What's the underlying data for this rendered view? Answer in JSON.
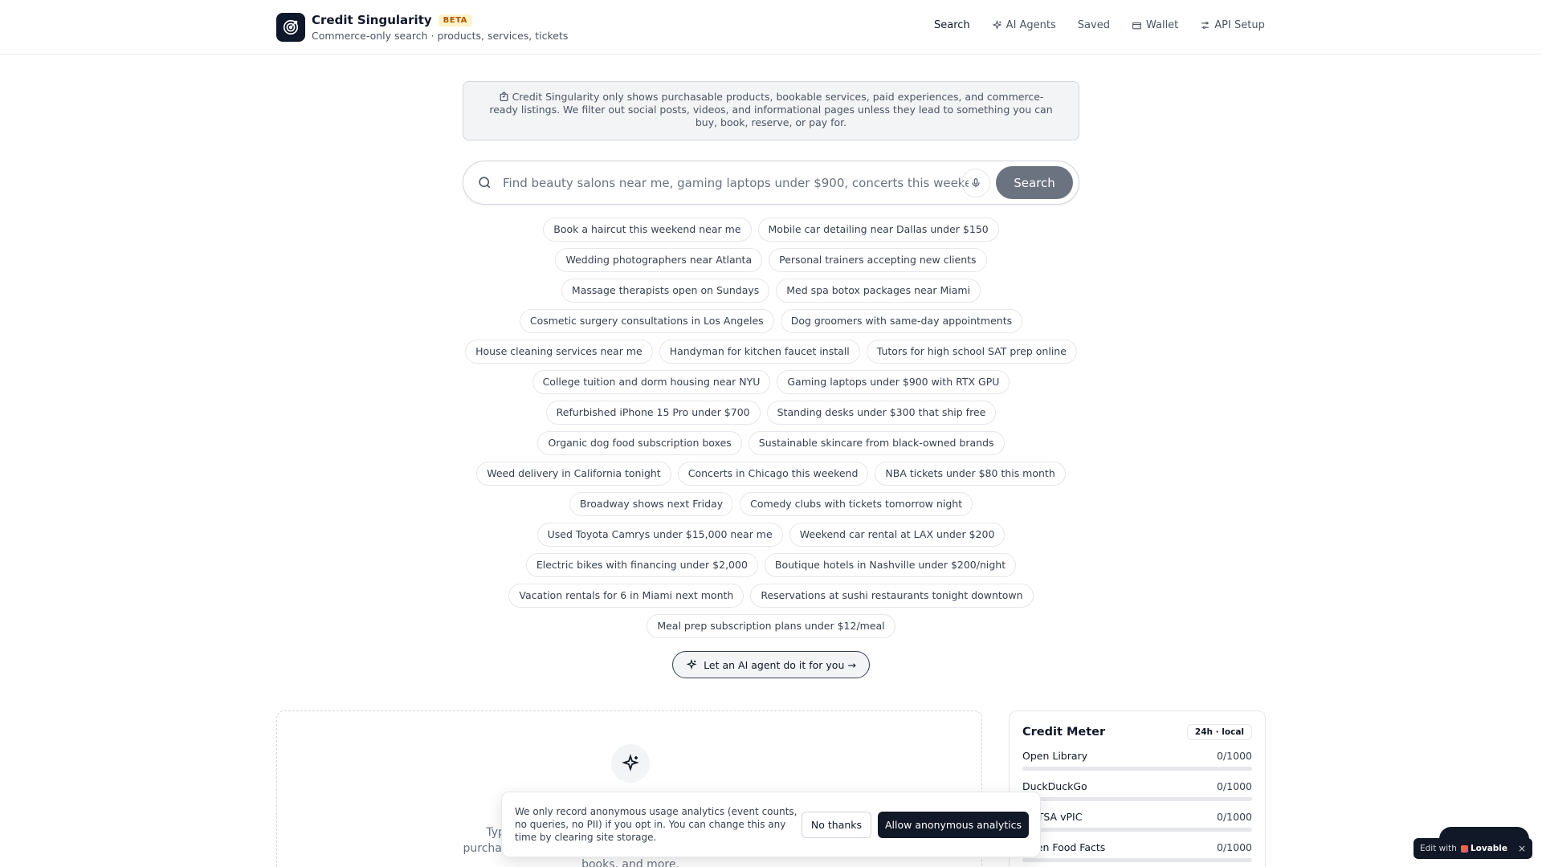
{
  "header": {
    "title": "Credit Singularity",
    "badge": "BETA",
    "subtitle": "Commerce-only search · products, services, tickets",
    "nav": [
      {
        "label": "Search",
        "icon": "none"
      },
      {
        "label": "AI Agents",
        "icon": "sparkles-icon"
      },
      {
        "label": "Saved",
        "icon": "none"
      },
      {
        "label": "Wallet",
        "icon": "wallet-icon"
      },
      {
        "label": "API Setup",
        "icon": "sliders-icon"
      }
    ]
  },
  "notice": {
    "text": "Credit Singularity only shows purchasable products, bookable services, paid experiences, and commerce-ready listings. We filter out social posts, videos, and informational pages unless they lead to something you can buy, book, reserve, or pay for."
  },
  "search": {
    "placeholder": "Find beauty salons near me, gaming laptops under $900, concerts this weekend",
    "button_label": "Search"
  },
  "suggestions": [
    [
      "Book a haircut this weekend near me",
      "Mobile car detailing near Dallas under $150"
    ],
    [
      "Wedding photographers near Atlanta",
      "Personal trainers accepting new clients"
    ],
    [
      "Massage therapists open on Sundays",
      "Med spa botox packages near Miami"
    ],
    [
      "Cosmetic surgery consultations in Los Angeles",
      "Dog groomers with same-day appointments"
    ],
    [
      "House cleaning services near me",
      "Handyman for kitchen faucet install",
      "Tutors for high school SAT prep online"
    ],
    [
      "College tuition and dorm housing near NYU",
      "Gaming laptops under $900 with RTX GPU"
    ],
    [
      "Refurbished iPhone 15 Pro under $700",
      "Standing desks under $300 that ship free"
    ],
    [
      "Organic dog food subscription boxes",
      "Sustainable skincare from black-owned brands"
    ],
    [
      "Weed delivery in California tonight",
      "Concerts in Chicago this weekend",
      "NBA tickets under $80 this month"
    ],
    [
      "Broadway shows next Friday",
      "Comedy clubs with tickets tomorrow night"
    ],
    [
      "Used Toyota Camrys under $15,000 near me",
      "Weekend car rental at LAX under $200"
    ],
    [
      "Electric bikes with financing under $2,000",
      "Boutique hotels in Nashville under $200/night"
    ],
    [
      "Vacation rentals for 6 in Miami next month",
      "Reservations at sushi restaurants tonight downtown"
    ],
    [
      "Meal prep subscription plans under $12/meal"
    ]
  ],
  "agent_cta": "Let an AI agent do it for you →",
  "empty_state": {
    "text": "Type a query or pick a suggestion to start browsing purchasable results across products, services, events, cars, books, and more."
  },
  "credit_meter": {
    "title": "Credit Meter",
    "badge": "24h · local",
    "sources": [
      {
        "name": "Open Library",
        "count": "0/1000",
        "used": 0
      },
      {
        "name": "DuckDuckGo",
        "count": "0/1000",
        "used": 0
      },
      {
        "name": "NHTSA vPIC",
        "count": "0/1000",
        "used": 0
      },
      {
        "name": "Open Food Facts",
        "count": "0/1000",
        "used": 0
      }
    ]
  },
  "cookie": {
    "text": "We only record anonymous usage analytics (event counts, no queries, no PII) if you opt in. You can change this any time by clearing site storage.",
    "decline_label": "No thanks",
    "accept_label": "Allow anonymous analytics"
  },
  "lovable": {
    "edit_label": "Edit with",
    "brand": "Lovable",
    "close": "×"
  },
  "colors": {
    "brand_dark": "#0f172a",
    "beta_text": "#b45309",
    "beta_bg": "#fef3c7",
    "search_button": "#6b7280"
  }
}
